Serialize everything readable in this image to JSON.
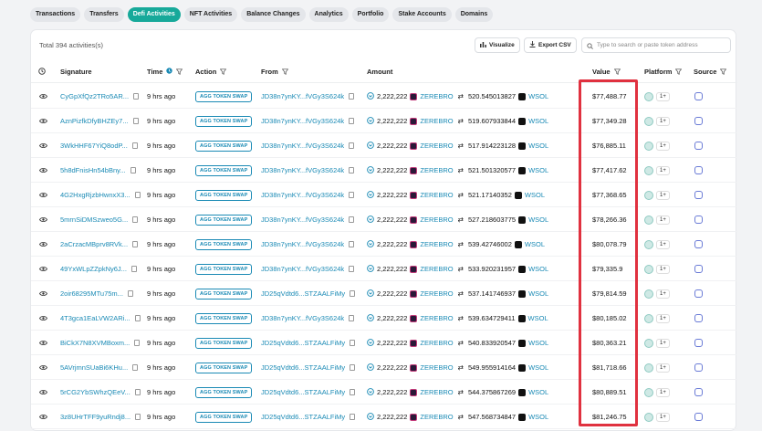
{
  "tabs": [
    "Transactions",
    "Transfers",
    "Defi Activities",
    "NFT Activities",
    "Balance Changes",
    "Analytics",
    "Portfolio",
    "Stake Accounts",
    "Domains"
  ],
  "active_tab": "Defi Activities",
  "toolbar": {
    "total": "Total 394 activities(s)",
    "visualize": "Visualize",
    "export": "Export CSV",
    "search_placeholder": "Type to search or paste token address"
  },
  "headers": {
    "signature": "Signature",
    "time": "Time",
    "action": "Action",
    "from": "From",
    "amount": "Amount",
    "value": "Value",
    "platform": "Platform",
    "source": "Source"
  },
  "rows": [
    {
      "sig": "CyGpXfQz2TRo5AR...",
      "time": "9 hrs ago",
      "action": "AGG TOKEN SWAP",
      "from": "JD38n7ynKY...fVGy3S624k",
      "amt_in": "2,222,222",
      "tok_in": "ZEREBRO",
      "amt_out": "520.545013827",
      "tok_out": "WSOL",
      "value": "$77,488.77",
      "plat": "1+"
    },
    {
      "sig": "AznPizfkDfyBHZEy7...",
      "time": "9 hrs ago",
      "action": "AGG TOKEN SWAP",
      "from": "JD38n7ynKY...fVGy3S624k",
      "amt_in": "2,222,222",
      "tok_in": "ZEREBRO",
      "amt_out": "519.607933844",
      "tok_out": "WSOL",
      "value": "$77,349.28",
      "plat": "1+"
    },
    {
      "sig": "3WkHHF67YiQ8odP...",
      "time": "9 hrs ago",
      "action": "AGG TOKEN SWAP",
      "from": "JD38n7ynKY...fVGy3S624k",
      "amt_in": "2,222,222",
      "tok_in": "ZEREBRO",
      "amt_out": "517.914223128",
      "tok_out": "WSOL",
      "value": "$76,885.11",
      "plat": "1+"
    },
    {
      "sig": "5h8dFnisHn54bBny...",
      "time": "9 hrs ago",
      "action": "AGG TOKEN SWAP",
      "from": "JD38n7ynKY...fVGy3S624k",
      "amt_in": "2,222,222",
      "tok_in": "ZEREBRO",
      "amt_out": "521.501320577",
      "tok_out": "WSOL",
      "value": "$77,417.62",
      "plat": "1+"
    },
    {
      "sig": "4G2HxgRjzbHwnxX3...",
      "time": "9 hrs ago",
      "action": "AGG TOKEN SWAP",
      "from": "JD38n7ynKY...fVGy3S624k",
      "amt_in": "2,222,222",
      "tok_in": "ZEREBRO",
      "amt_out": "521.17140352",
      "tok_out": "WSOL",
      "value": "$77,368.65",
      "plat": "1+"
    },
    {
      "sig": "5mrnSiDMSzweo5G...",
      "time": "9 hrs ago",
      "action": "AGG TOKEN SWAP",
      "from": "JD38n7ynKY...fVGy3S624k",
      "amt_in": "2,222,222",
      "tok_in": "ZEREBRO",
      "amt_out": "527.218603775",
      "tok_out": "WSOL",
      "value": "$78,266.36",
      "plat": "1+"
    },
    {
      "sig": "2aCrzacMBprv8RVk...",
      "time": "9 hrs ago",
      "action": "AGG TOKEN SWAP",
      "from": "JD38n7ynKY...fVGy3S624k",
      "amt_in": "2,222,222",
      "tok_in": "ZEREBRO",
      "amt_out": "539.42746002",
      "tok_out": "WSOL",
      "value": "$80,078.79",
      "plat": "1+"
    },
    {
      "sig": "49YxWLpZZpkNy6J...",
      "time": "9 hrs ago",
      "action": "AGG TOKEN SWAP",
      "from": "JD38n7ynKY...fVGy3S624k",
      "amt_in": "2,222,222",
      "tok_in": "ZEREBRO",
      "amt_out": "533.920231957",
      "tok_out": "WSOL",
      "value": "$79,335.9",
      "plat": "1+"
    },
    {
      "sig": "2oir68295MTu75m...",
      "time": "9 hrs ago",
      "action": "AGG TOKEN SWAP",
      "from": "JD25qVdtd6...STZAALFiMy",
      "amt_in": "2,222,222",
      "tok_in": "ZEREBRO",
      "amt_out": "537.141746937",
      "tok_out": "WSOL",
      "value": "$79,814.59",
      "plat": "1+"
    },
    {
      "sig": "4T3gca1EaLVW2ARi...",
      "time": "9 hrs ago",
      "action": "AGG TOKEN SWAP",
      "from": "JD38n7ynKY...fVGy3S624k",
      "amt_in": "2,222,222",
      "tok_in": "ZEREBRO",
      "amt_out": "539.634729411",
      "tok_out": "WSOL",
      "value": "$80,185.02",
      "plat": "1+"
    },
    {
      "sig": "BiCkX7N8XVMBoxm...",
      "time": "9 hrs ago",
      "action": "AGG TOKEN SWAP",
      "from": "JD25qVdtd6...STZAALFiMy",
      "amt_in": "2,222,222",
      "tok_in": "ZEREBRO",
      "amt_out": "540.833920547",
      "tok_out": "WSOL",
      "value": "$80,363.21",
      "plat": "1+"
    },
    {
      "sig": "5AVrjmnSUaBi6KHu...",
      "time": "9 hrs ago",
      "action": "AGG TOKEN SWAP",
      "from": "JD25qVdtd6...STZAALFiMy",
      "amt_in": "2,222,222",
      "tok_in": "ZEREBRO",
      "amt_out": "549.955914164",
      "tok_out": "WSOL",
      "value": "$81,718.66",
      "plat": "1+"
    },
    {
      "sig": "5rCG2YbSWhzQEeV...",
      "time": "9 hrs ago",
      "action": "AGG TOKEN SWAP",
      "from": "JD25qVdtd6...STZAALFiMy",
      "amt_in": "2,222,222",
      "tok_in": "ZEREBRO",
      "amt_out": "544.375867269",
      "tok_out": "WSOL",
      "value": "$80,889.51",
      "plat": "1+"
    },
    {
      "sig": "3z8UHrTFF9yuRndj8...",
      "time": "9 hrs ago",
      "action": "AGG TOKEN SWAP",
      "from": "JD25qVdtd6...STZAALFiMy",
      "amt_in": "2,222,222",
      "tok_in": "ZEREBRO",
      "amt_out": "547.568734847",
      "tok_out": "WSOL",
      "value": "$81,246.75",
      "plat": "1+"
    }
  ],
  "colors": {
    "accent": "#17a99a",
    "link": "#1a8ab5",
    "highlight": "#e0313f"
  }
}
